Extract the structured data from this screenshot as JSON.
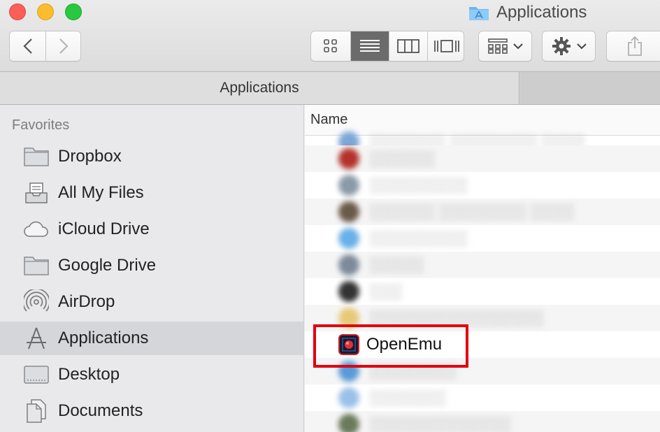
{
  "window": {
    "title": "Applications"
  },
  "toolbar": {
    "back_icon": "chevron-left-icon",
    "forward_icon": "chevron-right-icon",
    "view_modes": [
      "icon-view-icon",
      "list-view-icon",
      "column-view-icon",
      "cover-flow-icon"
    ],
    "active_view": "list-view-icon",
    "arrange_icon": "grid-arrange-icon",
    "action_icon": "gear-icon",
    "share_icon": "share-icon"
  },
  "tabbar": {
    "active_tab": "Applications"
  },
  "sidebar": {
    "heading": "Favorites",
    "items": [
      {
        "label": "Dropbox",
        "icon": "folder-icon"
      },
      {
        "label": "All My Files",
        "icon": "all-files-icon"
      },
      {
        "label": "iCloud Drive",
        "icon": "cloud-icon"
      },
      {
        "label": "Google Drive",
        "icon": "folder-icon"
      },
      {
        "label": "AirDrop",
        "icon": "airdrop-icon"
      },
      {
        "label": "Applications",
        "icon": "applications-icon",
        "selected": true
      },
      {
        "label": "Desktop",
        "icon": "desktop-icon"
      },
      {
        "label": "Documents",
        "icon": "documents-icon"
      }
    ]
  },
  "list": {
    "column_name": "Name",
    "highlighted_item": "OpenEmu"
  },
  "colors": {
    "highlight_border": "#e3000f",
    "selected_row": "#d5d6da",
    "active_segment": "#6b6b6b"
  }
}
